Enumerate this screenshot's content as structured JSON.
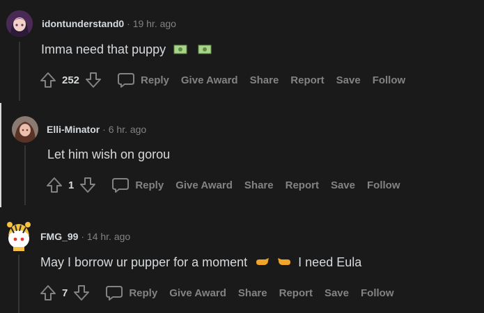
{
  "comments": [
    {
      "author": "idontunderstand0",
      "separator": "·",
      "time": "19 hr. ago",
      "text": "Imma need that puppy",
      "emojis": [
        "money-emoji",
        "money-emoji"
      ],
      "score": "252",
      "actions": {
        "reply": "Reply",
        "give_award": "Give Award",
        "share": "Share",
        "report": "Report",
        "save": "Save",
        "follow": "Follow"
      }
    },
    {
      "author": "Elli-Minator",
      "separator": "·",
      "time": "6 hr. ago",
      "text": "Let him wish on gorou",
      "score": "1",
      "actions": {
        "reply": "Reply",
        "give_award": "Give Award",
        "share": "Share",
        "report": "Report",
        "save": "Save",
        "follow": "Follow"
      }
    },
    {
      "author": "FMG_99",
      "separator": "·",
      "time": "14 hr. ago",
      "text_before": "May I borrow ur pupper for a moment",
      "emojis": [
        "pointing-right-emoji",
        "pointing-left-emoji"
      ],
      "text_after": "I need Eula",
      "score": "7",
      "actions": {
        "reply": "Reply",
        "give_award": "Give Award",
        "share": "Share",
        "report": "Report",
        "save": "Save",
        "follow": "Follow"
      }
    }
  ]
}
